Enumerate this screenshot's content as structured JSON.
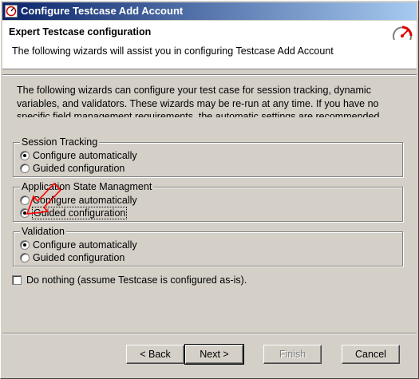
{
  "window": {
    "title": "Configure Testcase Add Account",
    "header_title": "Expert Testcase configuration",
    "header_description": "The following wizards will assist you in configuring Testcase Add Account"
  },
  "intro_text": "The following wizards can configure your test case for session tracking, dynamic variables, and validators. These wizards may be re-run at any time. If you have no specific field management requirements, the automatic settings are recommended.",
  "groups": {
    "session_tracking": {
      "label": "Session Tracking",
      "option_auto": "Configure automatically",
      "option_guided": "Guided configuration",
      "selected": "auto"
    },
    "app_state": {
      "label": "Application State Managment",
      "option_auto": "Configure automatically",
      "option_guided": "Guided configuration",
      "selected": "guided"
    },
    "validation": {
      "label": "Validation",
      "option_auto": "Configure automatically",
      "option_guided": "Guided configuration",
      "selected": "auto"
    }
  },
  "do_nothing": {
    "label": "Do nothing (assume Testcase is configured as-is).",
    "checked": false
  },
  "buttons": {
    "back": "< Back",
    "next": "Next >",
    "finish": "Finish",
    "cancel": "Cancel"
  },
  "colors": {
    "titlebar_start": "#0a246a",
    "titlebar_end": "#a6caf0",
    "dialog_bg": "#d4d0c8",
    "annotation_arrow": "#ff0000"
  },
  "icons": {
    "title": "testcase-app-icon",
    "header": "stopwatch-icon",
    "annotation": "red-arrow-annotation"
  }
}
